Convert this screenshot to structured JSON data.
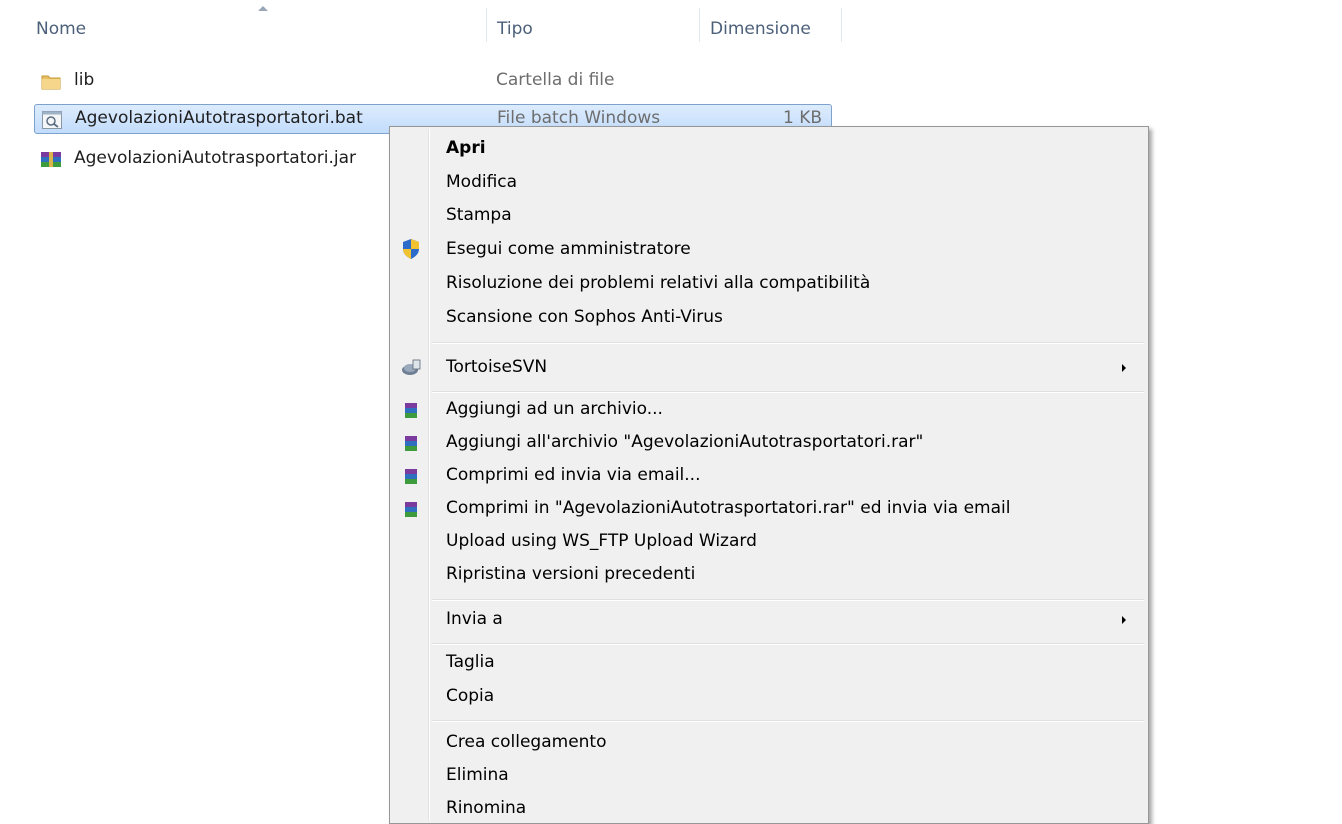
{
  "columns": {
    "name": "Nome",
    "type": "Tipo",
    "size": "Dimensione"
  },
  "files": [
    {
      "name": "lib",
      "type": "Cartella di file",
      "size": "",
      "icon": "folder-icon"
    },
    {
      "name": "AgevolazioniAutotrasportatori.bat",
      "type": "File batch Windows",
      "size": "1 KB",
      "icon": "batch-file-icon",
      "selected": true
    },
    {
      "name": "AgevolazioniAutotrasportatori.jar",
      "type": "",
      "size": "",
      "icon": "winrar-archive-icon"
    }
  ],
  "context_menu": {
    "group1": {
      "open": "Apri",
      "edit": "Modifica",
      "print": "Stampa",
      "run_as_admin": "Esegui come amministratore",
      "troubleshoot": "Risoluzione dei problemi relativi alla compatibilità",
      "scan": "Scansione con Sophos Anti-Virus"
    },
    "tortoise": "TortoiseSVN",
    "group3": {
      "add_archive": "Aggiungi ad un archivio...",
      "add_rar": "Aggiungi all'archivio \"AgevolazioniAutotrasportatori.rar\"",
      "compress_email": "Comprimi ed invia via email...",
      "compress_rar_email": "Comprimi in \"AgevolazioniAutotrasportatori.rar\" ed invia via email",
      "upload_wsftp": "Upload using WS_FTP Upload Wizard",
      "restore_versions": "Ripristina versioni precedenti"
    },
    "send_to": "Invia a",
    "cut": "Taglia",
    "copy": "Copia",
    "create_shortcut": "Crea collegamento",
    "delete": "Elimina",
    "rename": "Rinomina"
  }
}
